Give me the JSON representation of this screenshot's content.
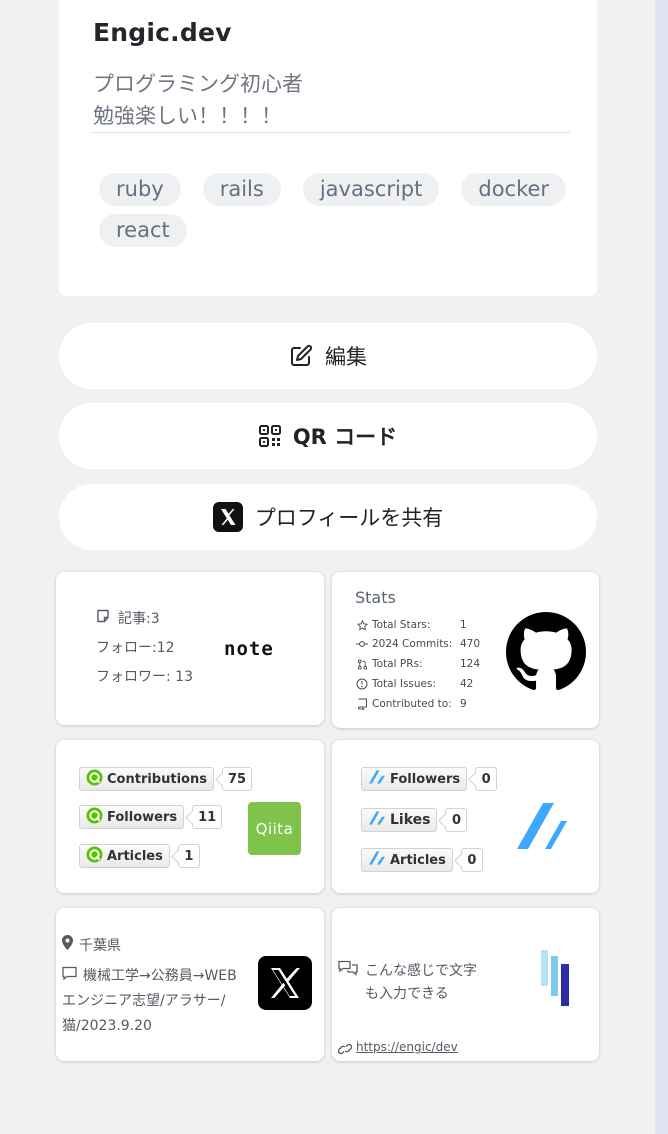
{
  "profile": {
    "name": "Engic.dev",
    "bio_lines": [
      "プログラミング初心者",
      "勉強楽しい！！！！"
    ],
    "tags": [
      "ruby",
      "rails",
      "javascript",
      "docker",
      "react"
    ]
  },
  "actions": {
    "edit_label": "編集",
    "qr_label": "QR コード",
    "share_label": "プロフィールを共有"
  },
  "note_card": {
    "articles": "記事:3",
    "follows": "フォロー:12",
    "followers": "フォロワー: 13",
    "logo": "note"
  },
  "github_stats": {
    "title": "Stats",
    "rows": [
      {
        "label": "Total Stars:",
        "value": "1",
        "icon": "star-icon"
      },
      {
        "label": "2024 Commits:",
        "value": "470",
        "icon": "commit-icon"
      },
      {
        "label": "Total PRs:",
        "value": "124",
        "icon": "pull-request-icon"
      },
      {
        "label": "Total Issues:",
        "value": "42",
        "icon": "issue-icon"
      },
      {
        "label": "Contributed to:",
        "value": "9",
        "icon": "repo-icon"
      }
    ]
  },
  "qiita": {
    "logo": "Qiita",
    "badges": [
      {
        "label": "Contributions",
        "count": "75"
      },
      {
        "label": "Followers",
        "count": "11"
      },
      {
        "label": "Articles",
        "count": "1"
      }
    ]
  },
  "zenn": {
    "badges": [
      {
        "label": "Followers",
        "count": "0"
      },
      {
        "label": "Likes",
        "count": "0"
      },
      {
        "label": "Articles",
        "count": "0"
      }
    ]
  },
  "x_card": {
    "location": "千葉県",
    "bio_lines": [
      "機械工学→公務員→WEB",
      "エンジニア志望/アラサー/",
      "猫/2023.9.20"
    ]
  },
  "free_card": {
    "text_lines": [
      "こんな感じで文字",
      "も入力できる"
    ],
    "link": "https://engic/dev"
  },
  "colors": {
    "background": "#f1f1f2",
    "qiita_green": "#7fc34a",
    "zenn_blue": "#3ea8ff"
  }
}
